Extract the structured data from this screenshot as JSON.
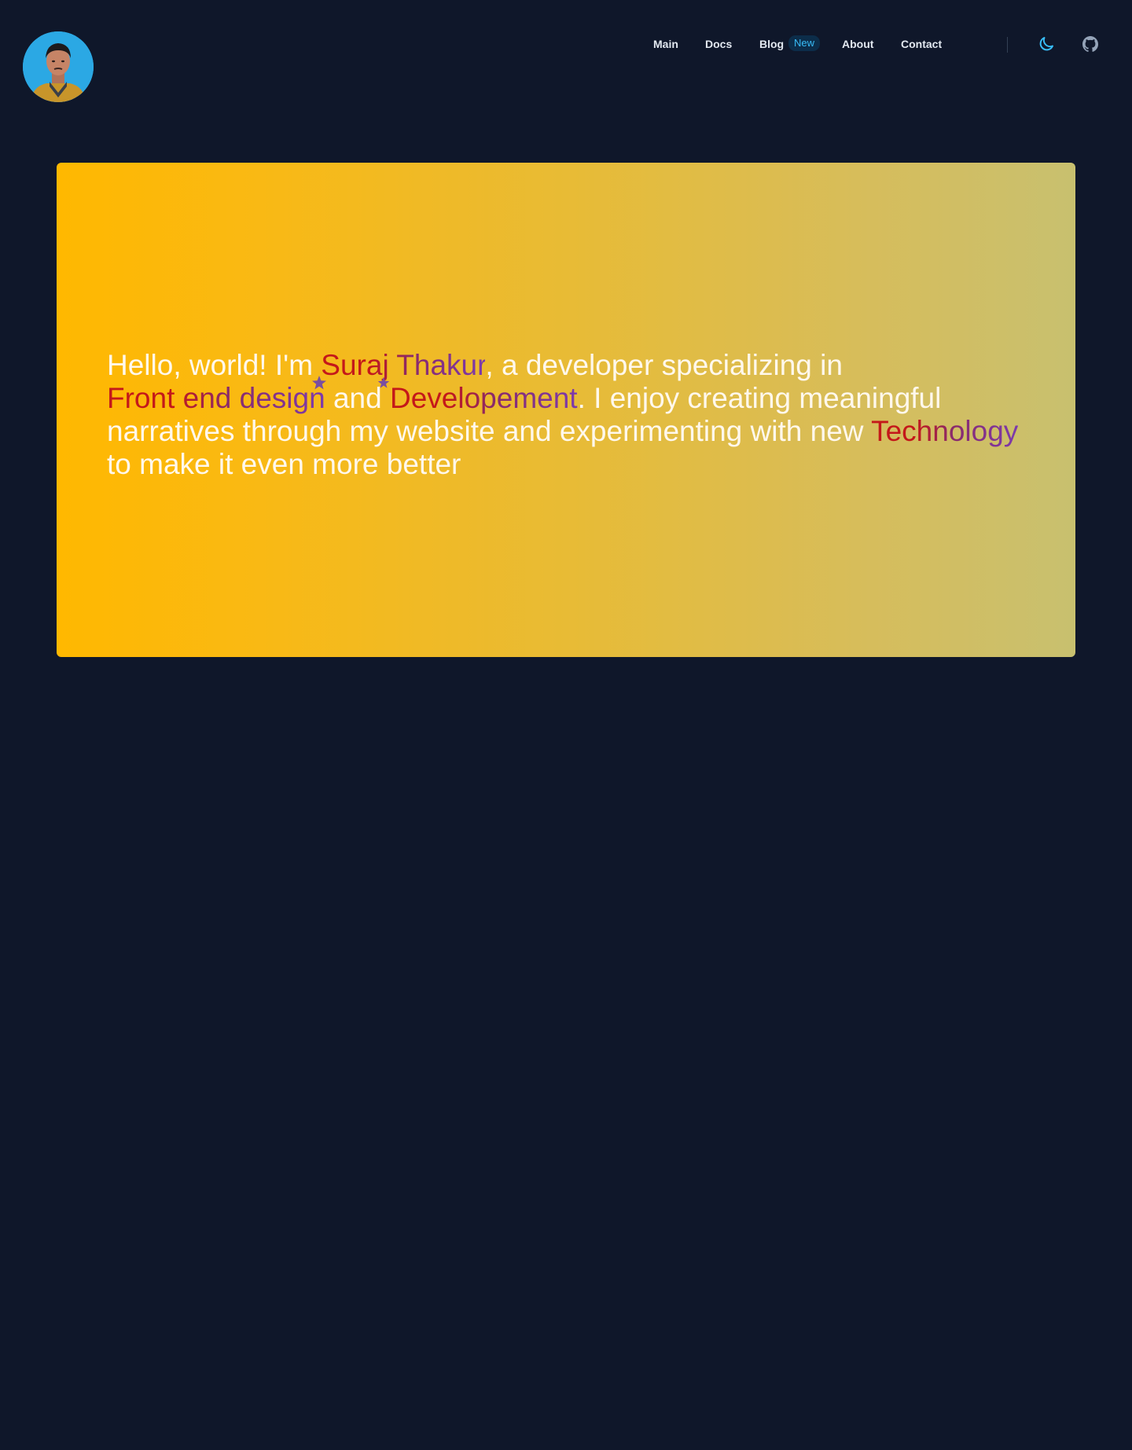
{
  "header": {
    "avatar_alt": "profile photo",
    "nav": [
      {
        "label": "Main"
      },
      {
        "label": "Docs"
      },
      {
        "label": "Blog",
        "badge": "New"
      },
      {
        "label": "About"
      },
      {
        "label": "Contact"
      }
    ],
    "icons": {
      "theme": "moon-icon",
      "github": "github-icon"
    }
  },
  "hero": {
    "segments": [
      {
        "text": "Hello, world! I'm ",
        "style": "plain"
      },
      {
        "text": "Suraj Thakur",
        "style": "gradient"
      },
      {
        "text": ", a developer specializing in ",
        "style": "plain"
      },
      {
        "text": "Front end design",
        "style": "gradient"
      },
      {
        "text": " and ",
        "style": "plain"
      },
      {
        "text": "Developement",
        "style": "gradient"
      },
      {
        "text": ". I enjoy creating meaningful narratives through my website and experimenting with new ",
        "style": "plain"
      },
      {
        "text": "Technology",
        "style": "gradient"
      },
      {
        "text": " to make it even more better",
        "style": "plain"
      }
    ]
  },
  "colors": {
    "page_bg": "#0f172a",
    "nav_text": "#e2e8f0",
    "badge_text": "#38bdf8",
    "badge_bg": "#0c2d4a",
    "hero_start": "#ffb800",
    "hero_end": "#c8c06f",
    "accent_red": "#c81e1e",
    "accent_purple": "#7c3aad"
  }
}
